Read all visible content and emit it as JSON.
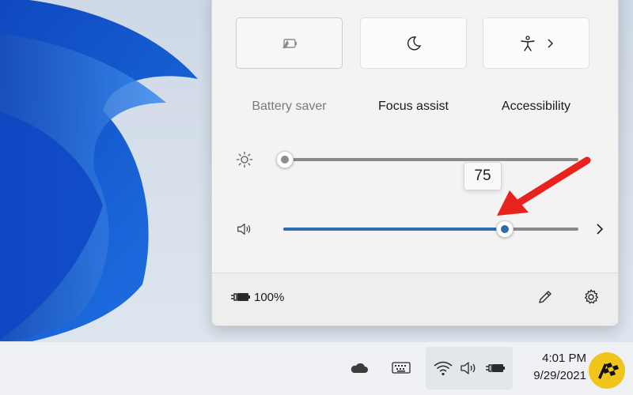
{
  "quick_settings": {
    "tiles": [
      {
        "label": "Battery saver",
        "icon": "battery-saver-icon",
        "state": "off"
      },
      {
        "label": "Focus assist",
        "icon": "moon-icon",
        "state": "on"
      },
      {
        "label": "Accessibility",
        "icon": "accessibility-icon",
        "state": "on",
        "has_chevron": true
      }
    ],
    "brightness": {
      "icon": "brightness-icon",
      "value": 0
    },
    "volume": {
      "icon": "speaker-icon",
      "value": 75,
      "tooltip": "75"
    },
    "footer": {
      "battery_icon": "battery-charging-icon",
      "battery_text": "100%",
      "edit_icon": "pencil-icon",
      "settings_icon": "gear-icon"
    }
  },
  "taskbar": {
    "icons": [
      "onedrive-cloud-icon",
      "touch-keyboard-icon",
      "wifi-icon",
      "speaker-icon",
      "battery-charging-icon"
    ],
    "time": "4:01 PM",
    "date": "9/29/2021"
  },
  "annotation": {
    "type": "red-arrow",
    "color": "#e8231d"
  },
  "colors": {
    "accent": "#2f6bb0",
    "wallpaper_blue": "#1c5fd1"
  }
}
